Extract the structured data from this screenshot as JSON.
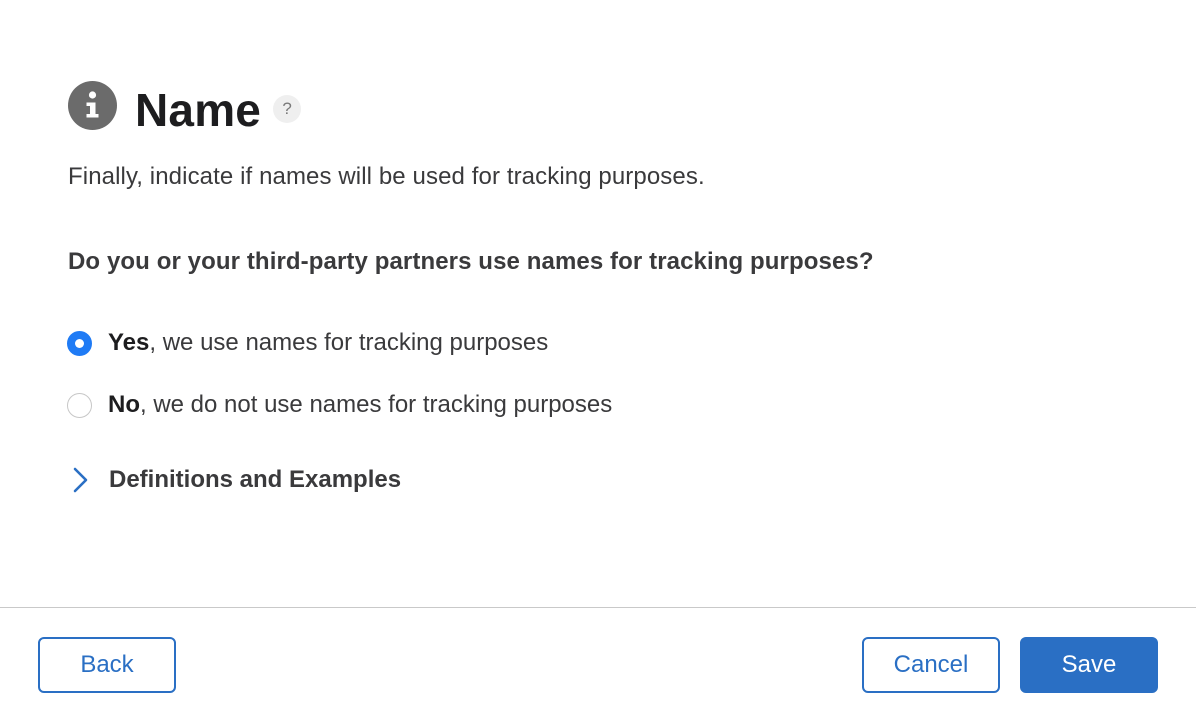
{
  "header": {
    "icon": "info-icon",
    "title": "Name",
    "help_icon": "help-icon",
    "help_glyph": "?"
  },
  "intro": "Finally, indicate if names will be used for tracking purposes.",
  "question": "Do you or your third-party partners use names for tracking purposes?",
  "options": [
    {
      "bold": "Yes",
      "rest": ", we use names for tracking purposes",
      "selected": true
    },
    {
      "bold": "No",
      "rest": ", we do not use names for tracking purposes",
      "selected": false
    }
  ],
  "disclosure": {
    "icon": "chevron-right-icon",
    "label": "Definitions and Examples"
  },
  "footer": {
    "back_label": "Back",
    "cancel_label": "Cancel",
    "save_label": "Save"
  },
  "colors": {
    "accent": "#2a6fc4",
    "radio_selected": "#1f7bf5",
    "icon_gray": "#6b6b6b"
  }
}
